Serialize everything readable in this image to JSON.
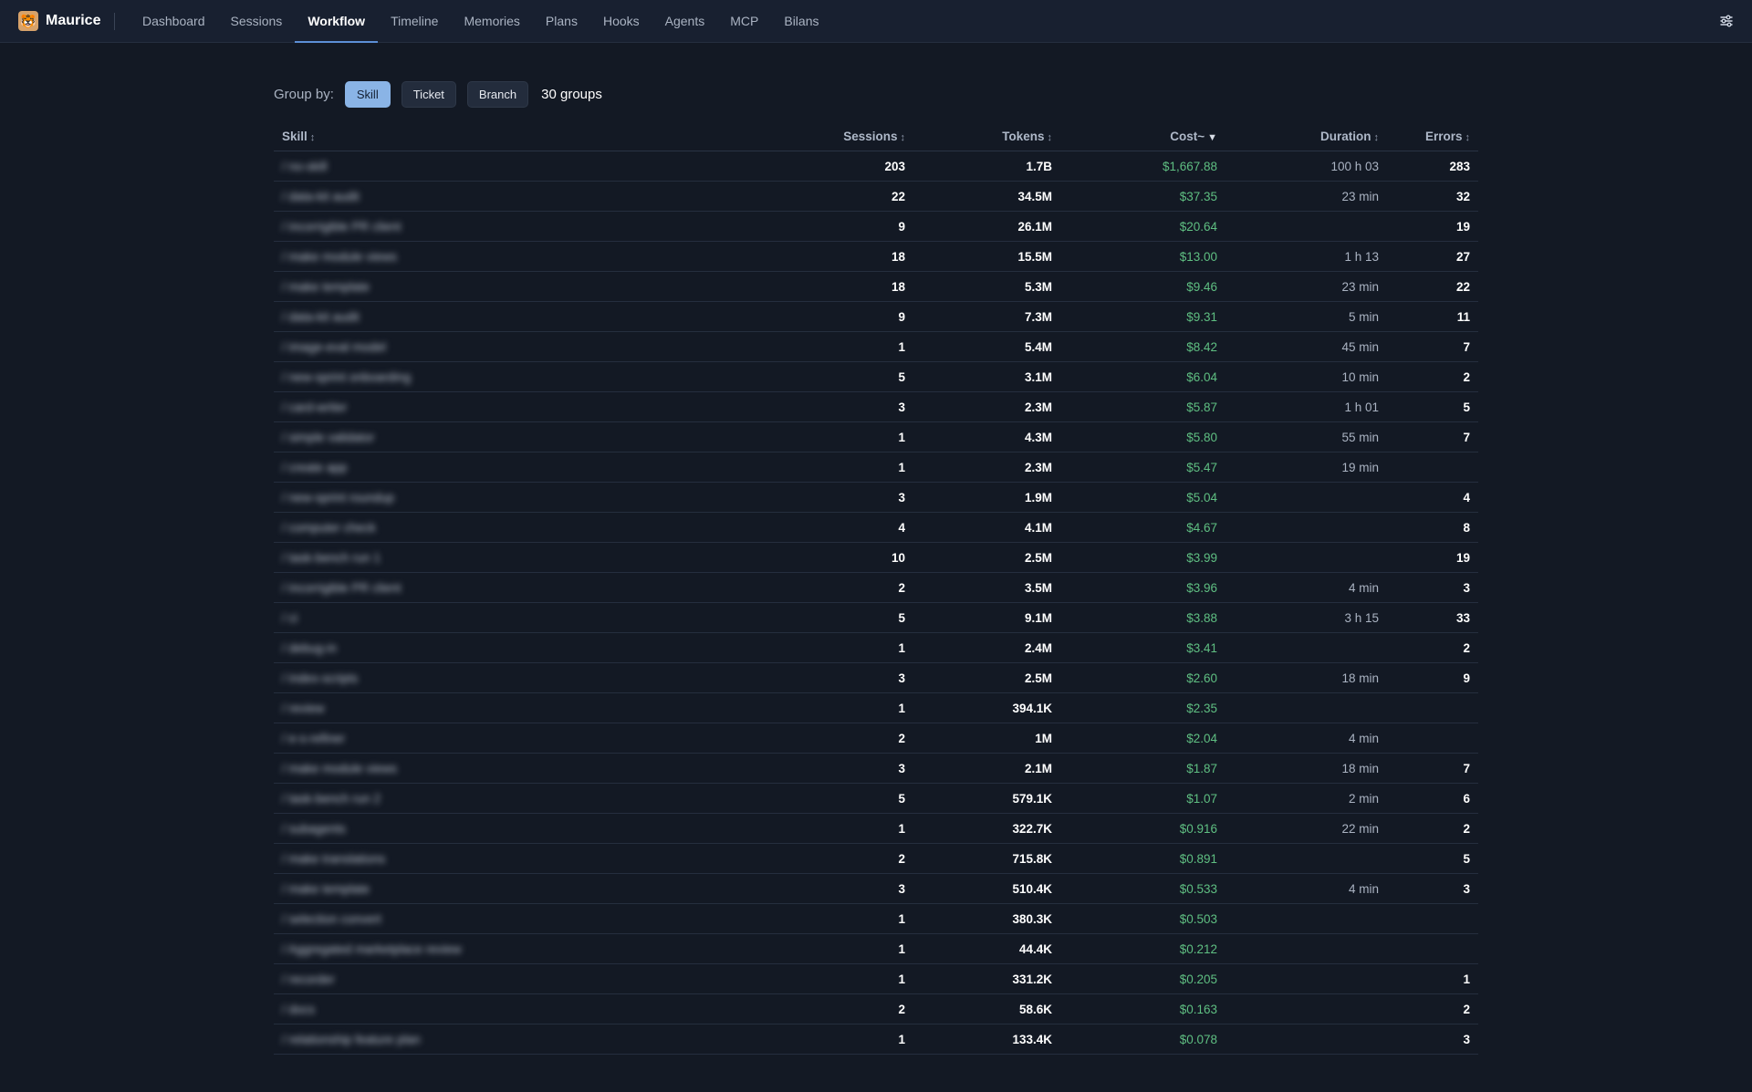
{
  "app": {
    "name": "Maurice",
    "logo_glyph": "🐯"
  },
  "nav": {
    "items": [
      {
        "label": "Dashboard"
      },
      {
        "label": "Sessions"
      },
      {
        "label": "Workflow",
        "active": true
      },
      {
        "label": "Timeline"
      },
      {
        "label": "Memories"
      },
      {
        "label": "Plans"
      },
      {
        "label": "Hooks"
      },
      {
        "label": "Agents"
      },
      {
        "label": "MCP"
      },
      {
        "label": "Bilans"
      }
    ],
    "settings_icon": "sliders-icon"
  },
  "group_by": {
    "label": "Group by:",
    "options": [
      {
        "label": "Skill",
        "active": true
      },
      {
        "label": "Ticket"
      },
      {
        "label": "Branch"
      }
    ],
    "count_label": "30 groups"
  },
  "table": {
    "columns": [
      {
        "key": "skill",
        "label": "Skill",
        "sort": "↕"
      },
      {
        "key": "sessions",
        "label": "Sessions",
        "sort": "↕"
      },
      {
        "key": "tokens",
        "label": "Tokens",
        "sort": "↕"
      },
      {
        "key": "cost",
        "label": "Cost~",
        "sort": "▼",
        "active": true
      },
      {
        "key": "duration",
        "label": "Duration",
        "sort": "↕"
      },
      {
        "key": "errors",
        "label": "Errors",
        "sort": "↕"
      }
    ],
    "rows": [
      {
        "skill": "/ no-skill",
        "sessions": "203",
        "tokens": "1.7B",
        "cost": "$1,667.88",
        "duration": "100 h 03",
        "errors": "283"
      },
      {
        "skill": "/ data-kit audit",
        "sessions": "22",
        "tokens": "34.5M",
        "cost": "$37.35",
        "duration": "23 min",
        "errors": "32"
      },
      {
        "skill": "/ incorrigible PR client",
        "sessions": "9",
        "tokens": "26.1M",
        "cost": "$20.64",
        "duration": "",
        "errors": "19"
      },
      {
        "skill": "/ make module views",
        "sessions": "18",
        "tokens": "15.5M",
        "cost": "$13.00",
        "duration": "1 h 13",
        "errors": "27"
      },
      {
        "skill": "/ make template",
        "sessions": "18",
        "tokens": "5.3M",
        "cost": "$9.46",
        "duration": "23 min",
        "errors": "22"
      },
      {
        "skill": "/ data-kit audit",
        "sessions": "9",
        "tokens": "7.3M",
        "cost": "$9.31",
        "duration": "5 min",
        "errors": "11"
      },
      {
        "skill": "/ image-eval model",
        "sessions": "1",
        "tokens": "5.4M",
        "cost": "$8.42",
        "duration": "45 min",
        "errors": "7"
      },
      {
        "skill": "/ new-sprint onboarding",
        "sessions": "5",
        "tokens": "3.1M",
        "cost": "$6.04",
        "duration": "10 min",
        "errors": "2"
      },
      {
        "skill": "/ card-writer",
        "sessions": "3",
        "tokens": "2.3M",
        "cost": "$5.87",
        "duration": "1 h 01",
        "errors": "5"
      },
      {
        "skill": "/ simple validator",
        "sessions": "1",
        "tokens": "4.3M",
        "cost": "$5.80",
        "duration": "55 min",
        "errors": "7"
      },
      {
        "skill": "/ create app",
        "sessions": "1",
        "tokens": "2.3M",
        "cost": "$5.47",
        "duration": "19 min",
        "errors": ""
      },
      {
        "skill": "/ new-sprint roundup",
        "sessions": "3",
        "tokens": "1.9M",
        "cost": "$5.04",
        "duration": "",
        "errors": "4"
      },
      {
        "skill": "/ computer check",
        "sessions": "4",
        "tokens": "4.1M",
        "cost": "$4.67",
        "duration": "",
        "errors": "8"
      },
      {
        "skill": "/ task-bench run 1",
        "sessions": "10",
        "tokens": "2.5M",
        "cost": "$3.99",
        "duration": "",
        "errors": "19"
      },
      {
        "skill": "/ incorrigible PR client",
        "sessions": "2",
        "tokens": "3.5M",
        "cost": "$3.96",
        "duration": "4 min",
        "errors": "3"
      },
      {
        "skill": "/ ci",
        "sessions": "5",
        "tokens": "9.1M",
        "cost": "$3.88",
        "duration": "3 h 15",
        "errors": "33"
      },
      {
        "skill": "/ debug-in",
        "sessions": "1",
        "tokens": "2.4M",
        "cost": "$3.41",
        "duration": "",
        "errors": "2"
      },
      {
        "skill": "/ index-scripts",
        "sessions": "3",
        "tokens": "2.5M",
        "cost": "$2.60",
        "duration": "18 min",
        "errors": "9"
      },
      {
        "skill": "/ review",
        "sessions": "1",
        "tokens": "394.1K",
        "cost": "$2.35",
        "duration": "",
        "errors": ""
      },
      {
        "skill": "/ e-s-refiner",
        "sessions": "2",
        "tokens": "1M",
        "cost": "$2.04",
        "duration": "4 min",
        "errors": ""
      },
      {
        "skill": "/ make module views",
        "sessions": "3",
        "tokens": "2.1M",
        "cost": "$1.87",
        "duration": "18 min",
        "errors": "7"
      },
      {
        "skill": "/ task-bench run 2",
        "sessions": "5",
        "tokens": "579.1K",
        "cost": "$1.07",
        "duration": "2 min",
        "errors": "6"
      },
      {
        "skill": "/ subagents",
        "sessions": "1",
        "tokens": "322.7K",
        "cost": "$0.916",
        "duration": "22 min",
        "errors": "2"
      },
      {
        "skill": "/ make translations",
        "sessions": "2",
        "tokens": "715.8K",
        "cost": "$0.891",
        "duration": "",
        "errors": "5"
      },
      {
        "skill": "/ make template",
        "sessions": "3",
        "tokens": "510.4K",
        "cost": "$0.533",
        "duration": "4 min",
        "errors": "3"
      },
      {
        "skill": "/ selection convert",
        "sessions": "1",
        "tokens": "380.3K",
        "cost": "$0.503",
        "duration": "",
        "errors": ""
      },
      {
        "skill": "/ Aggregated marketplace review",
        "sessions": "1",
        "tokens": "44.4K",
        "cost": "$0.212",
        "duration": "",
        "errors": ""
      },
      {
        "skill": "/ recorder",
        "sessions": "1",
        "tokens": "331.2K",
        "cost": "$0.205",
        "duration": "",
        "errors": "1"
      },
      {
        "skill": "/ docs",
        "sessions": "2",
        "tokens": "58.6K",
        "cost": "$0.163",
        "duration": "",
        "errors": "2"
      },
      {
        "skill": "/ relationship feature plan",
        "sessions": "1",
        "tokens": "133.4K",
        "cost": "$0.078",
        "duration": "",
        "errors": "3"
      }
    ]
  }
}
